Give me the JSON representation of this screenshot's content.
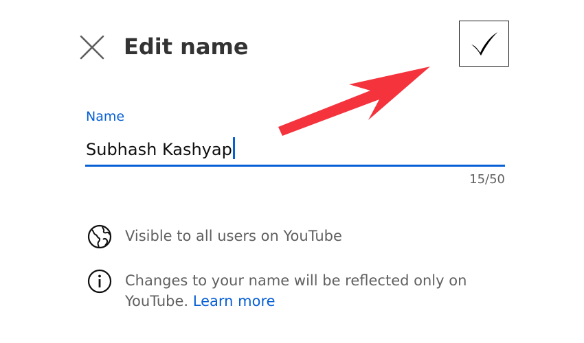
{
  "header": {
    "title": "Edit name",
    "close_icon": "close-icon",
    "confirm_icon": "checkmark-icon"
  },
  "name_field": {
    "label": "Name",
    "value": "Subhash Kashyap",
    "char_count": "15/50"
  },
  "info": {
    "visibility_icon": "globe-icon",
    "visibility_text": "Visible to all users on YouTube",
    "changes_icon": "info-icon",
    "changes_text": "Changes to your name will be reflected only on YouTube.",
    "learn_more": "Learn more"
  },
  "annotation": {
    "arrow_icon": "red-arrow-icon",
    "arrow_color": "#f4333d"
  },
  "colors": {
    "accent": "#065fd4",
    "secondary_text": "#606060",
    "title_text": "#333333"
  }
}
